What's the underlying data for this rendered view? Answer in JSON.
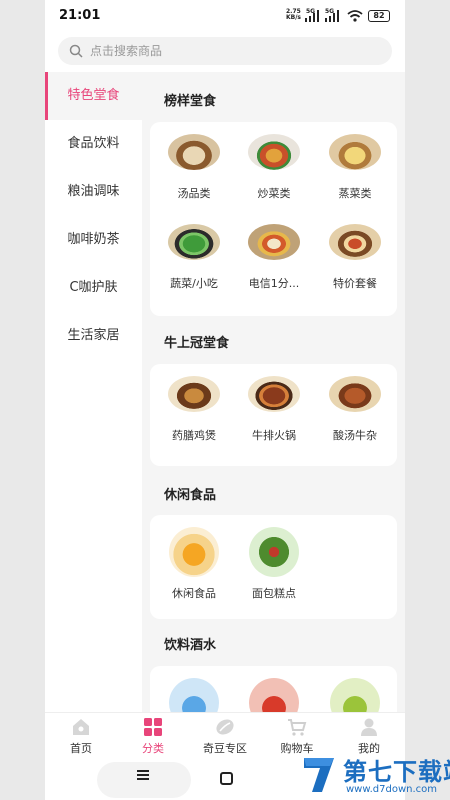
{
  "status_bar": {
    "time": "21:01",
    "network_speed": "2.75",
    "network_unit": "KB/s",
    "network_type_1": "5G",
    "network_type_2": "5G",
    "battery": "82"
  },
  "search": {
    "placeholder": "点击搜索商品"
  },
  "sidebar": {
    "items": [
      {
        "label": "特色堂食",
        "active": true
      },
      {
        "label": "食品饮料"
      },
      {
        "label": "粮油调味"
      },
      {
        "label": "咖啡奶茶"
      },
      {
        "label": "C咖护肤"
      },
      {
        "label": "生活家居"
      }
    ]
  },
  "sections": [
    {
      "title": "榜样堂食",
      "items": [
        {
          "label": "汤品类"
        },
        {
          "label": "炒菜类"
        },
        {
          "label": "蒸菜类"
        },
        {
          "label": "蔬菜/小吃"
        },
        {
          "label": "电信1分..."
        },
        {
          "label": "特价套餐"
        }
      ]
    },
    {
      "title": "牛上冠堂食",
      "items": [
        {
          "label": "药膳鸡煲"
        },
        {
          "label": "牛排火锅"
        },
        {
          "label": "酸汤牛杂"
        }
      ]
    },
    {
      "title": "休闲食品",
      "items": [
        {
          "label": "休闲食品"
        },
        {
          "label": "面包糕点"
        }
      ]
    },
    {
      "title": "饮料酒水",
      "items": [
        {
          "label": ""
        },
        {
          "label": ""
        },
        {
          "label": ""
        }
      ]
    }
  ],
  "tab_bar": {
    "items": [
      {
        "label": "首页",
        "icon": "home-icon"
      },
      {
        "label": "分类",
        "icon": "category-icon",
        "active": true
      },
      {
        "label": "奇豆专区",
        "icon": "bean-icon"
      },
      {
        "label": "购物车",
        "icon": "cart-icon"
      },
      {
        "label": "我的",
        "icon": "user-icon"
      }
    ]
  },
  "colors": {
    "accent": "#e8457a",
    "background": "#f5f5f5",
    "watermark": "#1c6ec0"
  },
  "watermark": {
    "name": "第七下载站",
    "url": "www.d7down.com"
  }
}
